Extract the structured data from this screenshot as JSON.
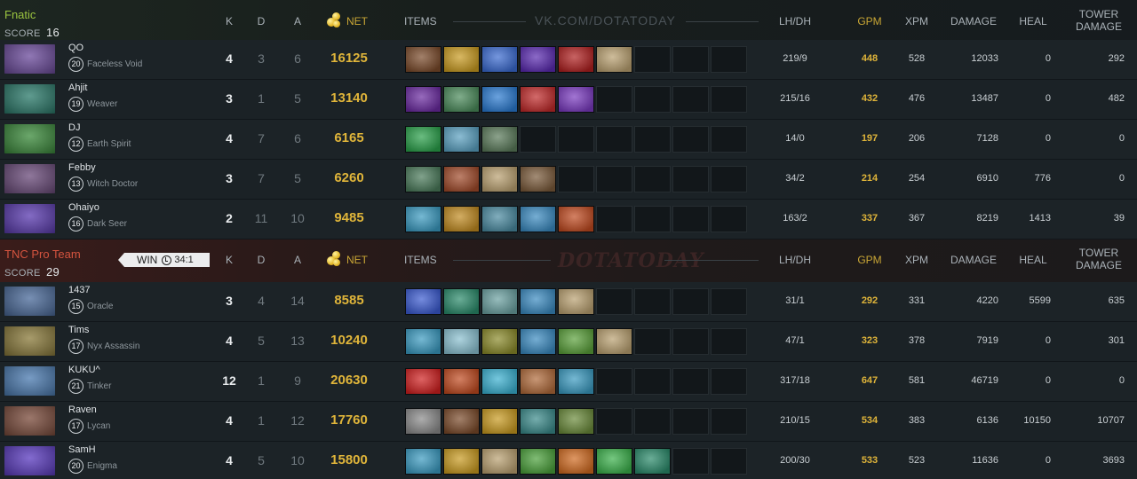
{
  "headers": {
    "k": "K",
    "d": "D",
    "a": "A",
    "net": "NET",
    "items": "ITEMS",
    "lhdh": "LH/DH",
    "gpm": "GPM",
    "xpm": "XPM",
    "damage": "DAMAGE",
    "heal": "HEAL",
    "tower_line1": "TOWER",
    "tower_line2": "DAMAGE"
  },
  "watermark_top": "VK.COM/DOTATODAY",
  "watermark_bottom": "DOTATODAY",
  "team1": {
    "name": "Fnatic",
    "score_label": "SCORE",
    "score": "16",
    "color": "#9bc43f",
    "players": [
      {
        "name": "QO",
        "level": "20",
        "hero": "Faceless Void",
        "k": "4",
        "d": "3",
        "a": "6",
        "net": "16125",
        "lhdh": "219/9",
        "gpm": "448",
        "xpm": "528",
        "damage": "12033",
        "heal": "0",
        "tower": "292",
        "portrait": "#6b4a9c",
        "items": [
          "#7a4a2a",
          "#c89a20",
          "#3a6ad0",
          "#5a2ab0",
          "#b02020",
          "#b9a070",
          "",
          "",
          ""
        ]
      },
      {
        "name": "Ahjit",
        "level": "19",
        "hero": "Weaver",
        "k": "3",
        "d": "1",
        "a": "5",
        "net": "13140",
        "lhdh": "215/16",
        "gpm": "432",
        "xpm": "476",
        "damage": "13487",
        "heal": "0",
        "tower": "482",
        "portrait": "#2a7a6a",
        "items": [
          "#6a2aa0",
          "#4a8a5a",
          "#2a7ad0",
          "#c02a2a",
          "#7a3ac0",
          "",
          "",
          "",
          ""
        ]
      },
      {
        "name": "DJ",
        "level": "12",
        "hero": "Earth Spirit",
        "k": "4",
        "d": "7",
        "a": "6",
        "net": "6165",
        "lhdh": "14/0",
        "gpm": "197",
        "xpm": "206",
        "damage": "7128",
        "heal": "0",
        "tower": "0",
        "portrait": "#3a8a3a",
        "items": [
          "#2aa04a",
          "#5aa0c0",
          "#5a7a5a",
          "",
          "",
          "",
          "",
          "",
          ""
        ]
      },
      {
        "name": "Febby",
        "level": "13",
        "hero": "Witch Doctor",
        "k": "3",
        "d": "7",
        "a": "5",
        "net": "6260",
        "lhdh": "34/2",
        "gpm": "214",
        "xpm": "254",
        "damage": "6910",
        "heal": "776",
        "tower": "0",
        "portrait": "#6a4a7a",
        "items": [
          "#4a7a5a",
          "#a04a2a",
          "#b9a070",
          "#7a5a3a",
          "",
          "",
          "",
          "",
          ""
        ]
      },
      {
        "name": "Ohaiyo",
        "level": "16",
        "hero": "Dark Seer",
        "k": "2",
        "d": "11",
        "a": "10",
        "net": "9485",
        "lhdh": "163/2",
        "gpm": "337",
        "xpm": "367",
        "damage": "8219",
        "heal": "1413",
        "tower": "39",
        "portrait": "#5a3ab0",
        "items": [
          "#3a9ac0",
          "#c08a20",
          "#4a8aa0",
          "#3a8ac0",
          "#c04a20",
          "",
          "",
          "",
          ""
        ]
      }
    ]
  },
  "team2": {
    "name": "TNC Pro Team",
    "score_label": "SCORE",
    "score": "29",
    "color": "#d4543f",
    "win_label": "WIN",
    "duration": "34:1",
    "players": [
      {
        "name": "1437",
        "level": "15",
        "hero": "Oracle",
        "k": "3",
        "d": "4",
        "a": "14",
        "net": "8585",
        "lhdh": "31/1",
        "gpm": "292",
        "xpm": "331",
        "damage": "4220",
        "heal": "5599",
        "tower": "635",
        "portrait": "#4a6a9a",
        "items": [
          "#3a5ad0",
          "#2a8a6a",
          "#6aa0a0",
          "#3a8ac0",
          "#b9a070",
          "",
          "",
          "",
          ""
        ]
      },
      {
        "name": "Tims",
        "level": "17",
        "hero": "Nyx Assassin",
        "k": "4",
        "d": "5",
        "a": "13",
        "net": "10240",
        "lhdh": "47/1",
        "gpm": "323",
        "xpm": "378",
        "damage": "7919",
        "heal": "0",
        "tower": "301",
        "portrait": "#8a7a3a",
        "items": [
          "#3a9ac0",
          "#8ac0d0",
          "#8a8a2a",
          "#3a8ac0",
          "#5aa03a",
          "#b9a070",
          "",
          "",
          ""
        ]
      },
      {
        "name": "KUKU^",
        "level": "21",
        "hero": "Tinker",
        "k": "12",
        "d": "1",
        "a": "9",
        "net": "20630",
        "lhdh": "317/18",
        "gpm": "647",
        "xpm": "581",
        "damage": "46719",
        "heal": "0",
        "tower": "0",
        "portrait": "#4a7ab0",
        "items": [
          "#d02020",
          "#c04a20",
          "#3ab0d0",
          "#b06a3a",
          "#3a9ac0",
          "",
          "",
          "",
          ""
        ]
      },
      {
        "name": "Raven",
        "level": "17",
        "hero": "Lycan",
        "k": "4",
        "d": "1",
        "a": "12",
        "net": "17760",
        "lhdh": "210/15",
        "gpm": "534",
        "xpm": "383",
        "damage": "6136",
        "heal": "10150",
        "tower": "10707",
        "portrait": "#7a4a3a",
        "items": [
          "#8a8a8a",
          "#7a4a2a",
          "#c89a20",
          "#3a8a8a",
          "#6a8a3a",
          "",
          "",
          "",
          ""
        ]
      },
      {
        "name": "SamH",
        "level": "20",
        "hero": "Enigma",
        "k": "4",
        "d": "5",
        "a": "10",
        "net": "15800",
        "lhdh": "200/30",
        "gpm": "533",
        "xpm": "523",
        "damage": "11636",
        "heal": "0",
        "tower": "3693",
        "portrait": "#5a3ac0",
        "items": [
          "#3a9ac0",
          "#c89a20",
          "#b9a070",
          "#4aa03a",
          "#d06a20",
          "#3ab04a",
          "#2a8a6a",
          "",
          ""
        ]
      }
    ]
  }
}
